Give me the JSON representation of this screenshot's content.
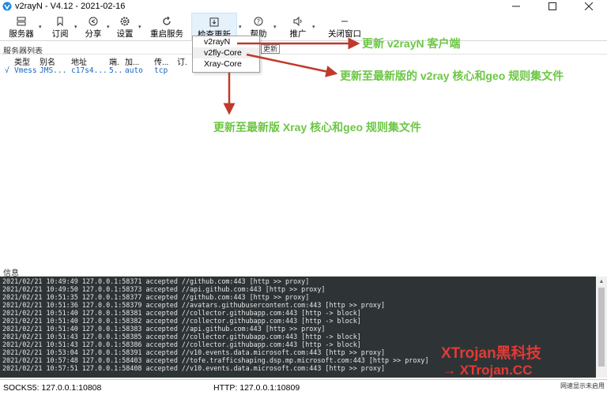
{
  "window": {
    "title": "v2rayN - V4.12 - 2021-02-16"
  },
  "toolbar": {
    "servers": "服务器",
    "subscription": "订阅",
    "share": "分享",
    "settings": "设置",
    "restart": "重启服务",
    "check_update": "检查更新",
    "help": "帮助",
    "promote": "推广",
    "close_window": "关闭窗口"
  },
  "update_menu": {
    "items": [
      "v2rayN",
      "v2fly-Core",
      "Xray-Core"
    ],
    "behind_text": "更新"
  },
  "server_list": {
    "label": "服务器列表",
    "columns": [
      "类型",
      "别名",
      "地址",
      "端.",
      "加...",
      "传...",
      "订."
    ],
    "rows": [
      {
        "check": "√",
        "type": "Vmess",
        "alias": "JMS...",
        "address": "c17s4...",
        "port": "5..",
        "security": "auto",
        "transport": "tcp"
      }
    ]
  },
  "annotations": {
    "a1": "更新 v2rayN 客户端",
    "a2": "更新至最新版的 v2ray 核心和geo 规则集文件",
    "a3": "更新至最新版 Xray 核心和geo 规则集文件"
  },
  "info": {
    "label": "信息",
    "logs": [
      "2021/02/21 10:49:49 127.0.0.1:58371 accepted //github.com:443 [http >> proxy]",
      "2021/02/21 10:49:50 127.0.0.1:58373 accepted //api.github.com:443 [http >> proxy]",
      "2021/02/21 10:51:35 127.0.0.1:58377 accepted //github.com:443 [http >> proxy]",
      "2021/02/21 10:51:36 127.0.0.1:58379 accepted //avatars.githubusercontent.com:443 [http >> proxy]",
      "2021/02/21 10:51:40 127.0.0.1:58381 accepted //collector.githubapp.com:443 [http -> block]",
      "2021/02/21 10:51:40 127.0.0.1:58382 accepted //collector.githubapp.com:443 [http -> block]",
      "2021/02/21 10:51:40 127.0.0.1:58383 accepted //api.github.com:443 [http >> proxy]",
      "2021/02/21 10:51:43 127.0.0.1:58385 accepted //collector.githubapp.com:443 [http -> block]",
      "2021/02/21 10:51:43 127.0.0.1:58386 accepted //collector.githubapp.com:443 [http -> block]",
      "2021/02/21 10:53:04 127.0.0.1:58391 accepted //v10.events.data.microsoft.com:443 [http >> proxy]",
      "2021/02/21 10:57:48 127.0.0.1:58403 accepted //tofe.trafficshaping.dsp.mp.microsoft.com:443 [http >> proxy]",
      "2021/02/21 10:57:51 127.0.0.1:58408 accepted //v10.events.data.microsoft.com:443 [http >> proxy]"
    ]
  },
  "watermark": {
    "line1": "XTrojan黑科技",
    "line2": "→ XTrojan.CC"
  },
  "status": {
    "socks": "SOCKS5:  127.0.0.1:10808",
    "http": "HTTP:  127.0.0.1:10809",
    "right": "网速显示未启用"
  },
  "colors": {
    "annotation": "#6cc644",
    "arrow": "#c0392b",
    "log_bg": "#2e3436",
    "link": "#1565c0",
    "watermark": "#e53935"
  }
}
